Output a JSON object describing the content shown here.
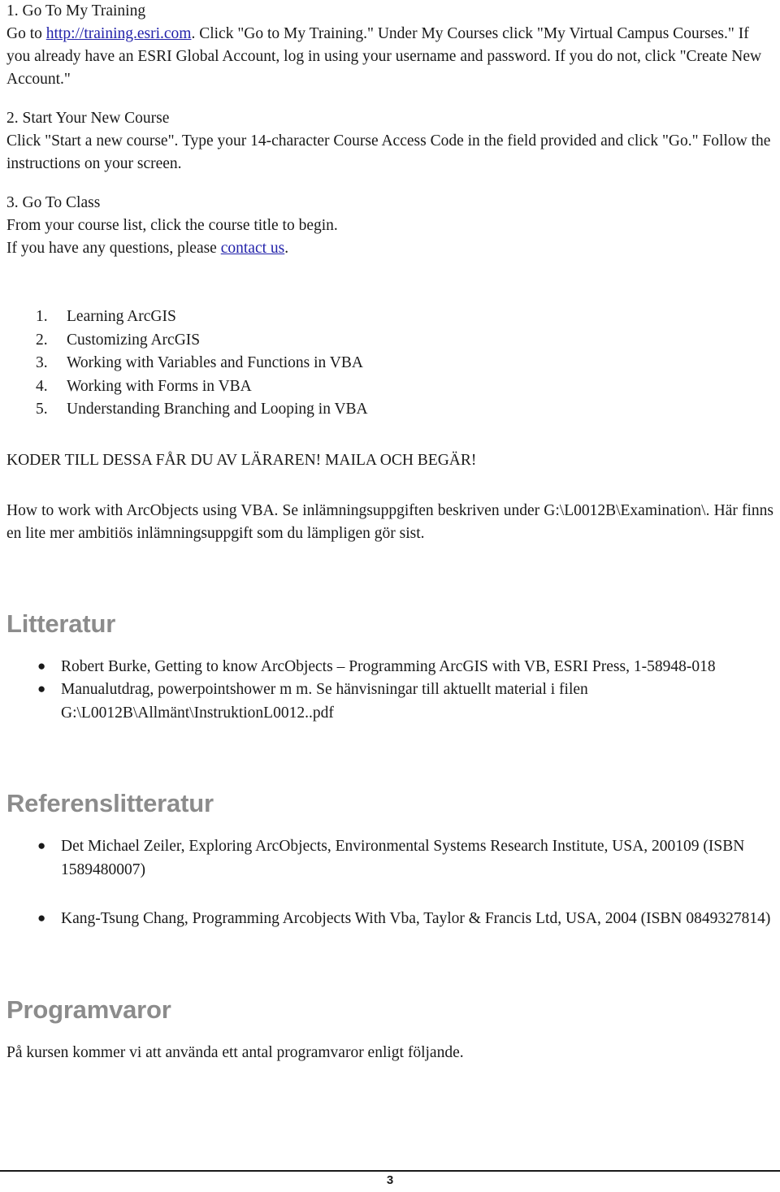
{
  "document": {
    "page_number": "3"
  },
  "training_steps": {
    "step1": {
      "heading": "1. Go To My Training",
      "text_before_link": "Go to ",
      "link_label": "http://training.esri.com",
      "text_after_link": ". Click \"Go to My Training.\" Under My Courses click \"My Virtual Campus Courses.\" If you already have an ESRI Global Account, log in using your username and password. If you do not, click \"Create New Account.\""
    },
    "step2": {
      "heading": "2. Start Your New Course",
      "text": "Click \"Start a new course\". Type your 14-character Course Access Code in the field provided and click \"Go.\" Follow the instructions on your screen."
    },
    "step3": {
      "heading": "3. Go To Class",
      "line1": "From your course list, click the course title to begin.",
      "line2_before_link": "If you have any questions, please ",
      "link_label": "contact us",
      "line2_after_link": "."
    }
  },
  "course_list": [
    {
      "num": "1.",
      "label": "Learning ArcGIS"
    },
    {
      "num": "2.",
      "label": "Customizing ArcGIS"
    },
    {
      "num": "3.",
      "label": "Working with Variables and Functions in VBA"
    },
    {
      "num": "4.",
      "label": "Working with Forms in VBA"
    },
    {
      "num": "5.",
      "label": "Understanding Branching and Looping in VBA"
    }
  ],
  "notice": {
    "codes_line": "KODER TILL DESSA FÅR DU AV LÄRAREN! MAILA OCH BEGÄR!",
    "assignment_paragraph": "How to work with ArcObjects using VBA. Se inlämningsuppgiften beskriven under G:\\L0012B\\Examination\\. Här finns en lite mer ambitiös inlämningsuppgift som du lämpligen gör sist."
  },
  "litteratur": {
    "heading": "Litteratur",
    "items": [
      "Robert Burke, Getting to know ArcObjects – Programming ArcGIS with VB, ESRI Press, 1-58948-018",
      "Manualutdrag, powerpointshower m m. Se hänvisningar till aktuellt material i filen G:\\L0012B\\Allmänt\\InstruktionL0012..pdf"
    ],
    "bullet_glyph": "●"
  },
  "referenslitteratur": {
    "heading": "Referenslitteratur",
    "items": [
      "Det Michael Zeiler, Exploring ArcObjects, Environmental Systems Research Institute, USA, 200109  (ISBN 1589480007)",
      "Kang-Tsung Chang,  Programming Arcobjects With Vba, Taylor & Francis Ltd, USA, 2004 (ISBN 0849327814)"
    ],
    "bullet_glyph": "●"
  },
  "programvaror": {
    "heading": "Programvaror",
    "text": "På kursen kommer vi att använda ett antal programvaror enligt följande."
  },
  "colors": {
    "heading_gray": "#8c8c8c",
    "link_blue": "#2222aa",
    "body_text": "#1a1a1a"
  }
}
